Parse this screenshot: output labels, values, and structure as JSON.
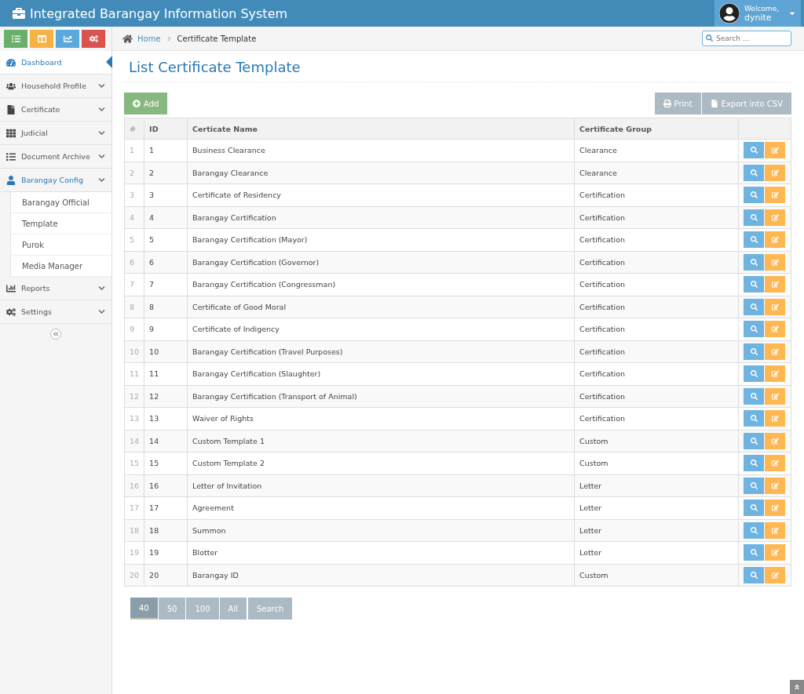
{
  "header": {
    "title": "Integrated Barangay Information System",
    "welcome": "Welcome,",
    "user": "dynite"
  },
  "shortcuts": [
    {
      "color": "#6ab06a"
    },
    {
      "color": "#f6b147"
    },
    {
      "color": "#5ba8dc"
    },
    {
      "color": "#d9534f"
    }
  ],
  "sidebar": {
    "items": [
      {
        "label": "Dashboard",
        "kind": "link",
        "selected": true,
        "expanded": false
      },
      {
        "label": "Household Profile",
        "kind": "menu",
        "selected": false,
        "expanded": false
      },
      {
        "label": "Certificate",
        "kind": "menu",
        "selected": false,
        "expanded": false
      },
      {
        "label": "Judicial",
        "kind": "menu",
        "selected": false,
        "expanded": false
      },
      {
        "label": "Document Archive",
        "kind": "menu",
        "selected": false,
        "expanded": false
      },
      {
        "label": "Barangay Config",
        "kind": "menu",
        "selected": false,
        "expanded": true,
        "children": [
          {
            "label": "Barangay Official"
          },
          {
            "label": "Template"
          },
          {
            "label": "Purok"
          },
          {
            "label": "Media Manager"
          }
        ]
      },
      {
        "label": "Reports",
        "kind": "menu",
        "selected": false,
        "expanded": false
      },
      {
        "label": "Settings",
        "kind": "menu",
        "selected": false,
        "expanded": false
      }
    ]
  },
  "breadcrumb": [
    {
      "label": "Home"
    },
    {
      "label": "Certificate Template"
    }
  ],
  "search": {
    "placeholder": "Search ..."
  },
  "page_title": "List Certificate Template",
  "toolbar": {
    "add": "Add",
    "print": "Print",
    "export": "Export into CSV"
  },
  "table": {
    "columns": [
      "#",
      "ID",
      "Certicate Name",
      "Certificate Group"
    ],
    "rows": [
      [
        "1",
        "1",
        "Business Clearance",
        "Clearance"
      ],
      [
        "2",
        "2",
        "Barangay Clearance",
        "Clearance"
      ],
      [
        "3",
        "3",
        "Certificate of Residency",
        "Certification"
      ],
      [
        "4",
        "4",
        "Barangay Certification",
        "Certification"
      ],
      [
        "5",
        "5",
        "Barangay Certification (Mayor)",
        "Certification"
      ],
      [
        "6",
        "6",
        "Barangay Certification (Governor)",
        "Certification"
      ],
      [
        "7",
        "7",
        "Barangay Certification (Congressman)",
        "Certification"
      ],
      [
        "8",
        "8",
        "Certificate of Good Moral",
        "Certification"
      ],
      [
        "9",
        "9",
        "Certificate of Indigency",
        "Certification"
      ],
      [
        "10",
        "10",
        "Barangay Certification (Travel Purposes)",
        "Certification"
      ],
      [
        "11",
        "11",
        "Barangay Certification (Slaughter)",
        "Certification"
      ],
      [
        "12",
        "12",
        "Barangay Certification (Transport of Animal)",
        "Certification"
      ],
      [
        "13",
        "13",
        "Waiver of Rights",
        "Certification"
      ],
      [
        "14",
        "14",
        "Custom Template 1",
        "Custom"
      ],
      [
        "15",
        "15",
        "Custom Template 2",
        "Custom"
      ],
      [
        "16",
        "16",
        "Letter of Invitation",
        "Letter"
      ],
      [
        "17",
        "17",
        "Agreement",
        "Letter"
      ],
      [
        "18",
        "18",
        "Summon",
        "Letter"
      ],
      [
        "19",
        "19",
        "Blotter",
        "Letter"
      ],
      [
        "20",
        "20",
        "Barangay ID",
        "Custom"
      ]
    ]
  },
  "page_sizes": [
    {
      "label": "40",
      "selected": true
    },
    {
      "label": "50",
      "selected": false
    },
    {
      "label": "100",
      "selected": false
    },
    {
      "label": "All",
      "selected": false
    }
  ],
  "search_button": "Search"
}
